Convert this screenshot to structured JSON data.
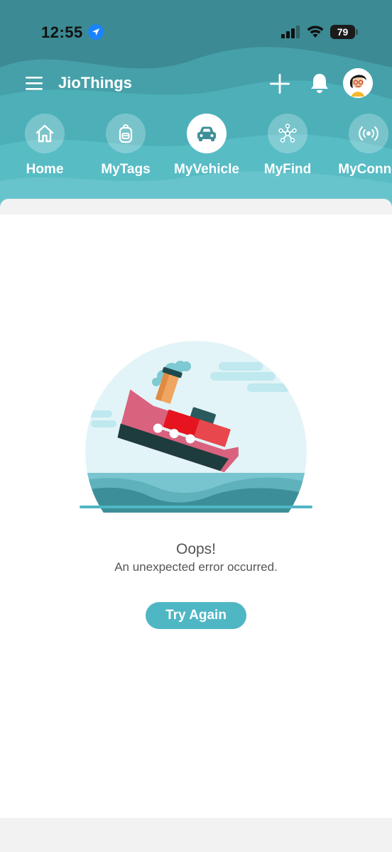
{
  "status_bar": {
    "time": "12:55",
    "battery": "79"
  },
  "app_bar": {
    "title": "JioThings"
  },
  "nav": {
    "items": [
      {
        "label": "Home",
        "icon": "home-icon"
      },
      {
        "label": "MyTags",
        "icon": "backpack-icon"
      },
      {
        "label": "MyVehicle",
        "icon": "car-icon",
        "active": true
      },
      {
        "label": "MyFind",
        "icon": "network-icon"
      },
      {
        "label": "MyConne",
        "icon": "broadcast-icon"
      }
    ]
  },
  "error": {
    "title": "Oops!",
    "message": "An unexpected error occurred.",
    "retry_label": "Try Again"
  },
  "colors": {
    "header": "#3f8f97",
    "accent": "#4fb6c4",
    "ship_hull": "#d9627e",
    "ship_cabin": "#e5141e"
  }
}
